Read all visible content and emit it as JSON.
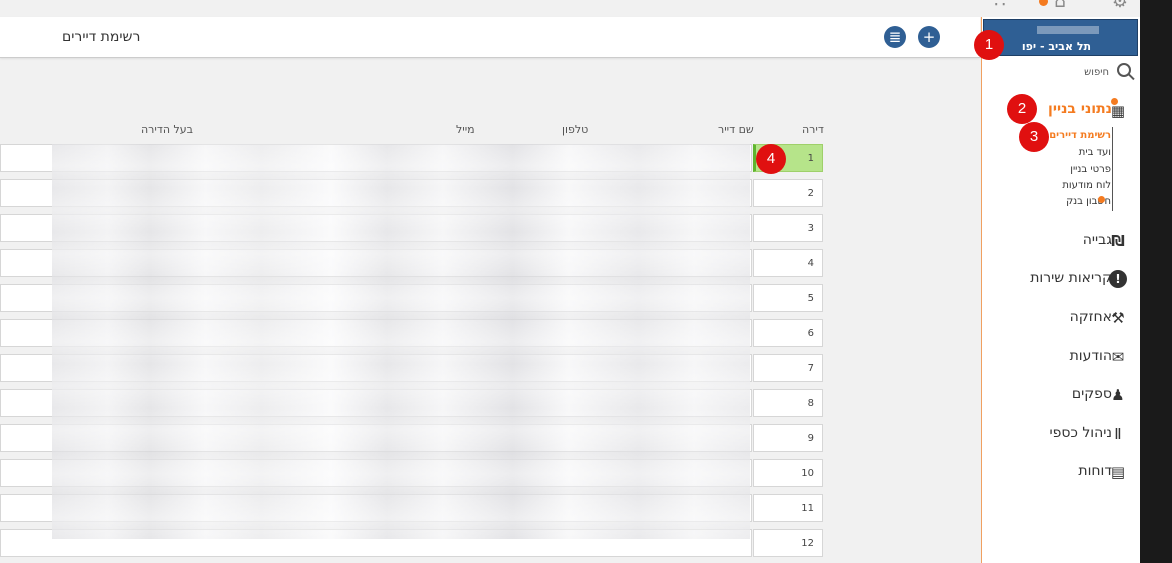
{
  "header": {
    "title": "רשימת דיירים"
  },
  "table": {
    "columns": {
      "apartment": "דירה",
      "tenant_name": "שם דייר",
      "phone": "טלפון",
      "email": "מייל",
      "owner": "בעל הדירה"
    },
    "rows": [
      "1",
      "2",
      "3",
      "4",
      "5",
      "6",
      "7",
      "8",
      "9",
      "10",
      "11",
      "12"
    ]
  },
  "sidebar": {
    "building_name": "תל אביב - יפו",
    "search_label": "חיפוש",
    "nav": {
      "building_data": "נתוני בניין",
      "collection": "גבייה",
      "service_calls": "קריאות שירות",
      "maintenance": "אחזקה",
      "messages": "הודעות",
      "suppliers": "ספקים",
      "financial": "ניהול כספי",
      "reports": "דוחות"
    },
    "sub_nav": {
      "tenant_list": "רשימת דיירים",
      "house_committee": "ועד בית",
      "building_details": "פרטי בניין",
      "notice_board": "לוח מודעות",
      "bank_account": "חשבון בנק"
    }
  },
  "annotations": [
    "1",
    "2",
    "3",
    "4"
  ],
  "colors": {
    "accent": "#f47b20",
    "primary": "#2f5f94",
    "selected_row": "#b6e48a",
    "badge": "#e01010"
  }
}
